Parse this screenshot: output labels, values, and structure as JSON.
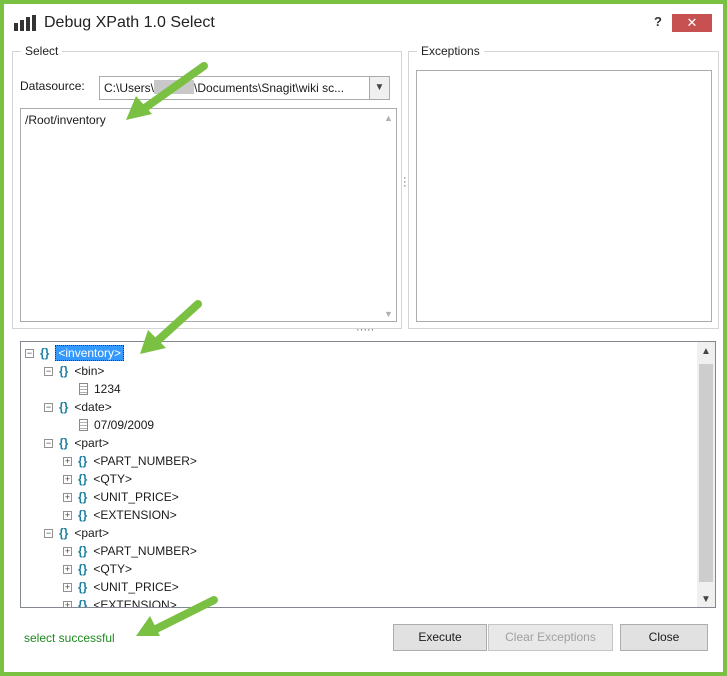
{
  "window": {
    "title": "Debug XPath 1.0 Select",
    "help_label": "?",
    "close_label": "✕"
  },
  "select_group": {
    "label": "Select",
    "datasource_label": "Datasource:",
    "datasource_value_prefix": "C:\\Users\\",
    "datasource_value_suffix": "\\Documents\\Snagit\\wiki sc...",
    "query": "/Root/inventory"
  },
  "exceptions_group": {
    "label": "Exceptions"
  },
  "tree": {
    "nodes": [
      {
        "label": "<inventory>",
        "depth": 0,
        "kind": "element",
        "expander": "−",
        "selected": true
      },
      {
        "label": "<bin>",
        "depth": 1,
        "kind": "element",
        "expander": "−"
      },
      {
        "label": "1234",
        "depth": 2,
        "kind": "text"
      },
      {
        "label": "<date>",
        "depth": 1,
        "kind": "element",
        "expander": "−"
      },
      {
        "label": "07/09/2009",
        "depth": 2,
        "kind": "text"
      },
      {
        "label": "<part>",
        "depth": 1,
        "kind": "element",
        "expander": "−"
      },
      {
        "label": "<PART_NUMBER>",
        "depth": 2,
        "kind": "element",
        "expander": "+"
      },
      {
        "label": "<QTY>",
        "depth": 2,
        "kind": "element",
        "expander": "+"
      },
      {
        "label": "<UNIT_PRICE>",
        "depth": 2,
        "kind": "element",
        "expander": "+"
      },
      {
        "label": "<EXTENSION>",
        "depth": 2,
        "kind": "element",
        "expander": "+"
      },
      {
        "label": "<part>",
        "depth": 1,
        "kind": "element",
        "expander": "−"
      },
      {
        "label": "<PART_NUMBER>",
        "depth": 2,
        "kind": "element",
        "expander": "+"
      },
      {
        "label": "<QTY>",
        "depth": 2,
        "kind": "element",
        "expander": "+"
      },
      {
        "label": "<UNIT_PRICE>",
        "depth": 2,
        "kind": "element",
        "expander": "+"
      },
      {
        "label": "<EXTENSION>",
        "depth": 2,
        "kind": "element",
        "expander": "+"
      }
    ]
  },
  "status": {
    "text": "select successful"
  },
  "buttons": {
    "execute": "Execute",
    "clear_exceptions": "Clear Exceptions",
    "close": "Close"
  },
  "colors": {
    "frame": "#7ac143",
    "status": "#1e8a1e",
    "selection": "#3399ff",
    "node_icon": "#1a7fa0"
  }
}
